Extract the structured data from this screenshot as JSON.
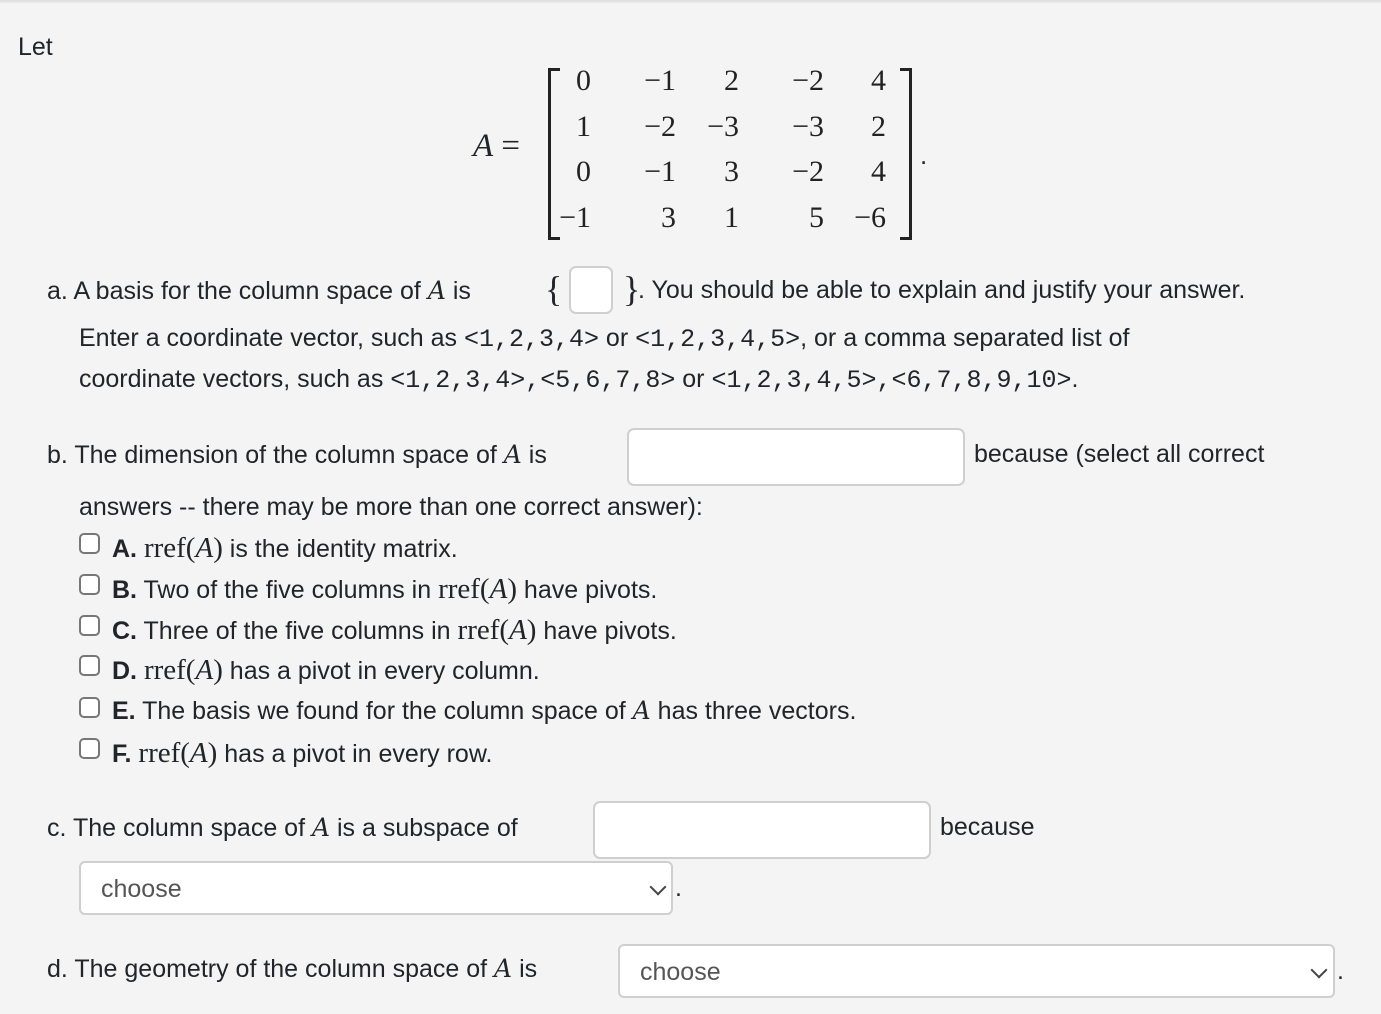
{
  "intro": "Let",
  "matrix": {
    "name": "A",
    "equals": "=",
    "trailing": ".",
    "rows": [
      [
        "0",
        "−1",
        "2",
        "−2",
        "4"
      ],
      [
        "1",
        "−2",
        "−3",
        "−3",
        "2"
      ],
      [
        "0",
        "−1",
        "3",
        "−2",
        "4"
      ],
      [
        "−1",
        "3",
        "1",
        "5",
        "−6"
      ]
    ]
  },
  "part_a": {
    "label": "a.",
    "text_before": "A basis for the column space of",
    "var": "A",
    "text_is": "is",
    "brace_open": "{",
    "brace_close": "}",
    "text_after": ". You should be able to explain and justify your answer.",
    "basis_input_value": "",
    "hint_line1_pre": "Enter a coordinate vector, such as ",
    "hint_ex1": "<1,2,3,4>",
    "hint_or1": " or ",
    "hint_ex2": "<1,2,3,4,5>",
    "hint_line1_post": ", or a comma separated list of",
    "hint_line2_pre": "coordinate vectors, such as ",
    "hint_ex3": "<1,2,3,4>,<5,6,7,8>",
    "hint_or2": " or ",
    "hint_ex4": "<1,2,3,4,5>,<6,7,8,9,10>",
    "hint_line2_post": "."
  },
  "part_b": {
    "label": "b.",
    "text_before": "The dimension of the column space of",
    "var": "A",
    "text_is": "is",
    "dimension_input_value": "",
    "text_after": "because (select all correct",
    "text_line2": "answers -- there may be more than one correct answer):",
    "options": [
      {
        "letter": "A.",
        "pre": "",
        "rref": true,
        "post": " is the identity matrix.",
        "checked": false
      },
      {
        "letter": "B.",
        "pre": " Two of the five columns in ",
        "rref": true,
        "post": " have pivots.",
        "checked": false
      },
      {
        "letter": "C.",
        "pre": " Three of the five columns in ",
        "rref": true,
        "post": " have pivots.",
        "checked": false
      },
      {
        "letter": "D.",
        "pre": "",
        "rref": true,
        "post": " has a pivot in every column.",
        "checked": false
      },
      {
        "letter": "E.",
        "pre": " The basis we found for the column space of ",
        "var": "A",
        "post": " has three vectors.",
        "checked": false
      },
      {
        "letter": "F.",
        "pre": "",
        "rref": true,
        "post": " has a pivot in every row.",
        "checked": false
      }
    ],
    "rref_text": "rref",
    "rref_arg": "A"
  },
  "part_c": {
    "label": "c.",
    "text_before": "The column space of",
    "var": "A",
    "text_after": "is a subspace of",
    "subspace_input_value": "",
    "because": "because",
    "select_value": "choose",
    "trailing": "."
  },
  "part_d": {
    "label": "d.",
    "text_before": "The geometry of the column space of",
    "var": "A",
    "text_is": "is",
    "select_value": "choose",
    "trailing": "."
  }
}
